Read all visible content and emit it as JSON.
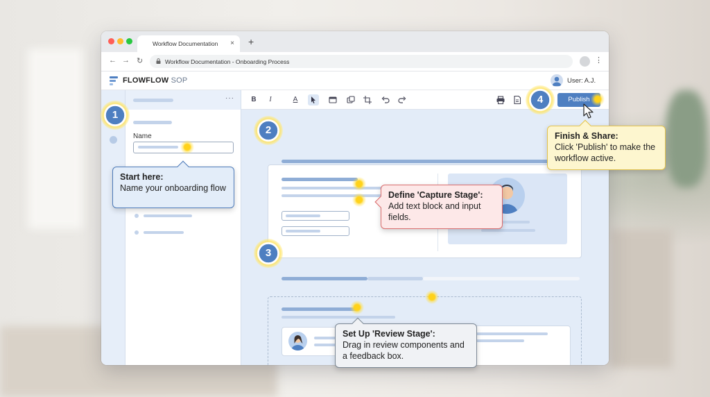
{
  "browser": {
    "tab_title": "Workflow Documentation",
    "tab_close": "×",
    "new_tab": "+",
    "url_text": "Workflow Documentation - Onboarding Process",
    "nav_back": "←",
    "nav_forward": "→",
    "nav_reload": "↻",
    "menu": "⋮"
  },
  "app": {
    "brand": "FLOWFLOW",
    "brand_suffix": "SOP",
    "user_label": "User: A.J."
  },
  "panel": {
    "more": "···",
    "name_label": "Name"
  },
  "toolbar": {
    "bold": "B",
    "italic": "I",
    "underline_a": "A",
    "publish_label": "Publish"
  },
  "steps": [
    "1",
    "2",
    "3",
    "4"
  ],
  "callouts": {
    "start": {
      "title": "Start here:",
      "body": "Name your onboarding flow"
    },
    "capture": {
      "title": "Define 'Capture Stage':",
      "body": "Add text block and input fields."
    },
    "review": {
      "title": "Set Up 'Review Stage':",
      "body": "Drag in review components and a feedback box."
    },
    "finish": {
      "title": "Finish & Share:",
      "body": "Click 'Publish' to make the workflow active."
    }
  },
  "colors": {
    "accent": "#4e7fc1",
    "highlight": "#ffd21a"
  }
}
